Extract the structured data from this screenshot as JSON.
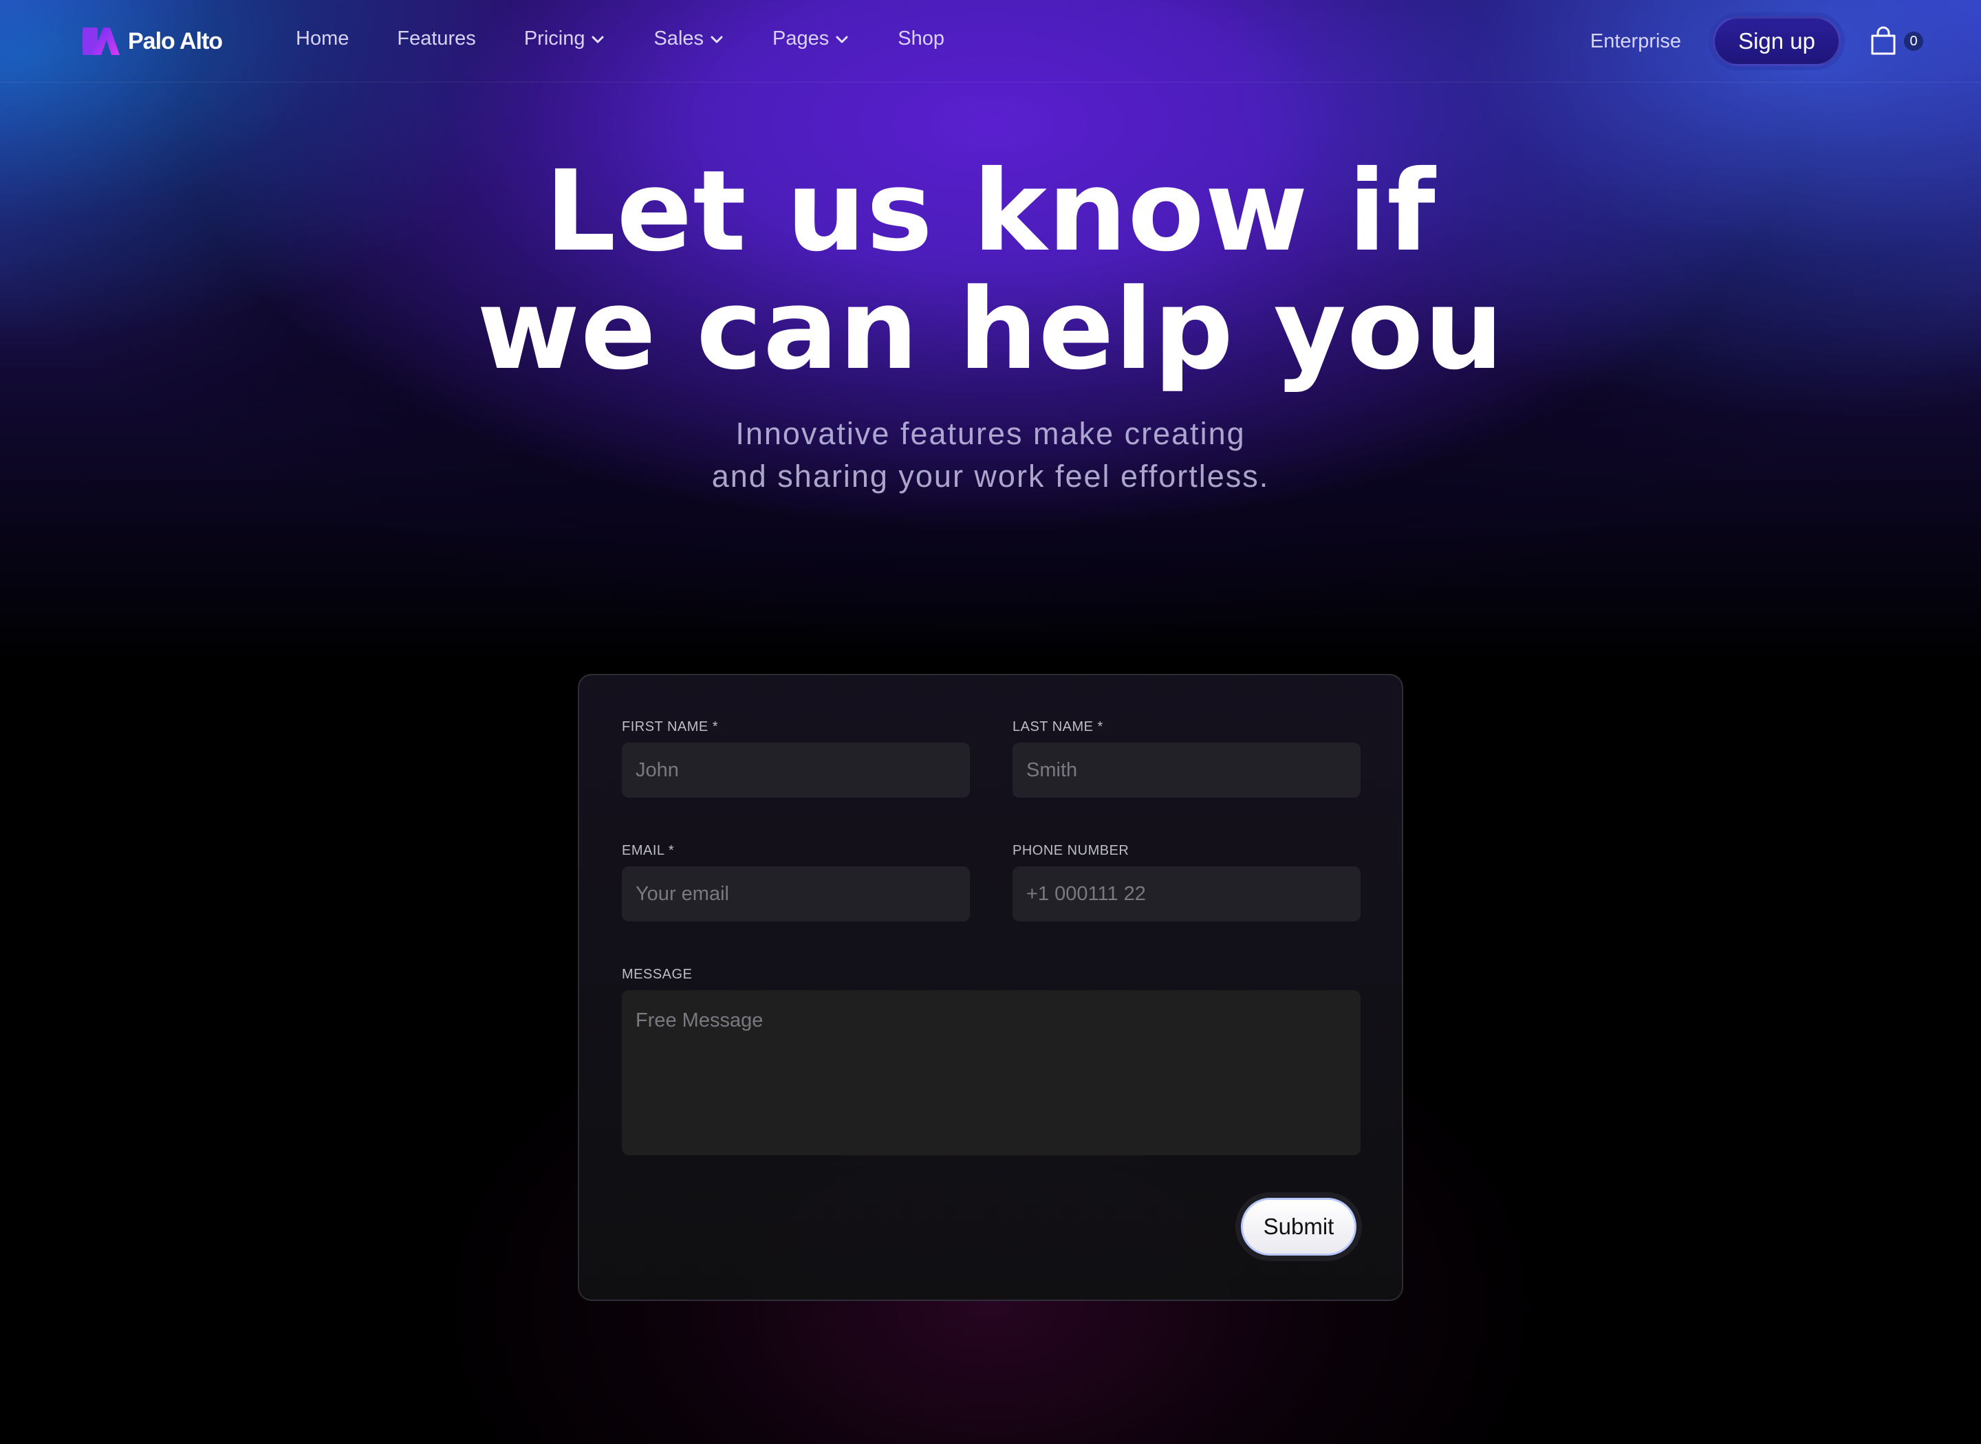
{
  "brand": {
    "name": "Palo Alto"
  },
  "nav": {
    "items": [
      {
        "label": "Home",
        "has_dropdown": false
      },
      {
        "label": "Features",
        "has_dropdown": false
      },
      {
        "label": "Pricing",
        "has_dropdown": true
      },
      {
        "label": "Sales",
        "has_dropdown": true
      },
      {
        "label": "Pages",
        "has_dropdown": true
      },
      {
        "label": "Shop",
        "has_dropdown": false
      }
    ],
    "enterprise_label": "Enterprise",
    "signup_label": "Sign up",
    "cart_count": "0",
    "cart_icon": "shopping-bag-icon"
  },
  "hero": {
    "title_line1": "Let us know if",
    "title_line2": "we can help you",
    "subtitle_line1": "Innovative features make creating",
    "subtitle_line2": "and sharing your work feel effortless."
  },
  "form": {
    "first_name": {
      "label": "FIRST NAME *",
      "placeholder": "John"
    },
    "last_name": {
      "label": "LAST NAME *",
      "placeholder": "Smith"
    },
    "email": {
      "label": "EMAIL *",
      "placeholder": "Your email"
    },
    "phone": {
      "label": "PHONE NUMBER",
      "placeholder": "+1 000111 22"
    },
    "message": {
      "label": "MESSAGE",
      "placeholder": "Free Message"
    },
    "submit_label": "Submit"
  },
  "colors": {
    "accent_purple": "#5a1fcf",
    "accent_blue": "#3a40c8",
    "signup_bg": "#1e157a",
    "logo_gradient_start": "#7b2ff7",
    "logo_gradient_end": "#d13cf5"
  }
}
